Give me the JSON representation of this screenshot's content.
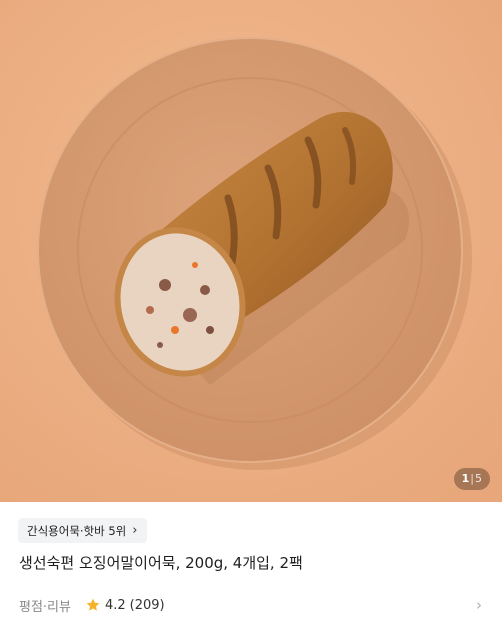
{
  "image": {
    "alt": "생선숙편 오징어말이어묵",
    "pager": {
      "current": "1",
      "separator": "|",
      "total": "5"
    }
  },
  "product": {
    "badge_label": "간식용어묵·핫바 5위",
    "title": "생선숙편 오징어말이어묵, 200g, 4개입, 2팩"
  },
  "rating": {
    "label": "평점·리뷰",
    "score": "4.2",
    "count": "(209)"
  },
  "icons": {
    "badge_chevron": "chevron-right-icon",
    "star": "star-icon",
    "row_chevron": "chevron-right-icon"
  },
  "colors": {
    "background": "#EDB084",
    "plate": "#D49870",
    "star": "#F5B32C"
  }
}
